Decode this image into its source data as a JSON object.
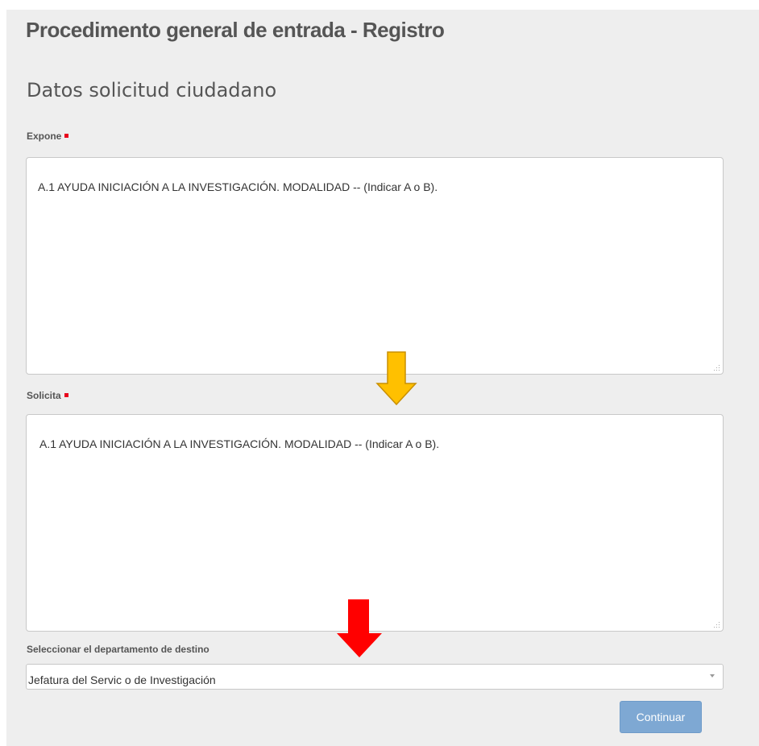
{
  "header": {
    "title": "Procedimento general de entrada - Registro",
    "section_title": "Datos solicitud ciudadano"
  },
  "form": {
    "expone": {
      "label": "Expone",
      "value": "A.1 AYUDA INICIACIÓN A LA INVESTIGACIÓN. MODALIDAD -- (Indicar A o B)."
    },
    "solicita": {
      "label": "Solicita",
      "value": "A.1 AYUDA INICIACIÓN A LA INVESTIGACIÓN. MODALIDAD -- (Indicar A o B)."
    },
    "department": {
      "label": "Seleccionar el departamento de destino",
      "selected": "Jefatura del Servic o de Investigación"
    },
    "continue_label": "Continuar"
  },
  "annotations": {
    "arrow_yellow_color": "#ffc000",
    "arrow_red_color": "#ff0000"
  },
  "colors": {
    "required_marker": "#e8001c",
    "button": "#7ea8d3"
  }
}
